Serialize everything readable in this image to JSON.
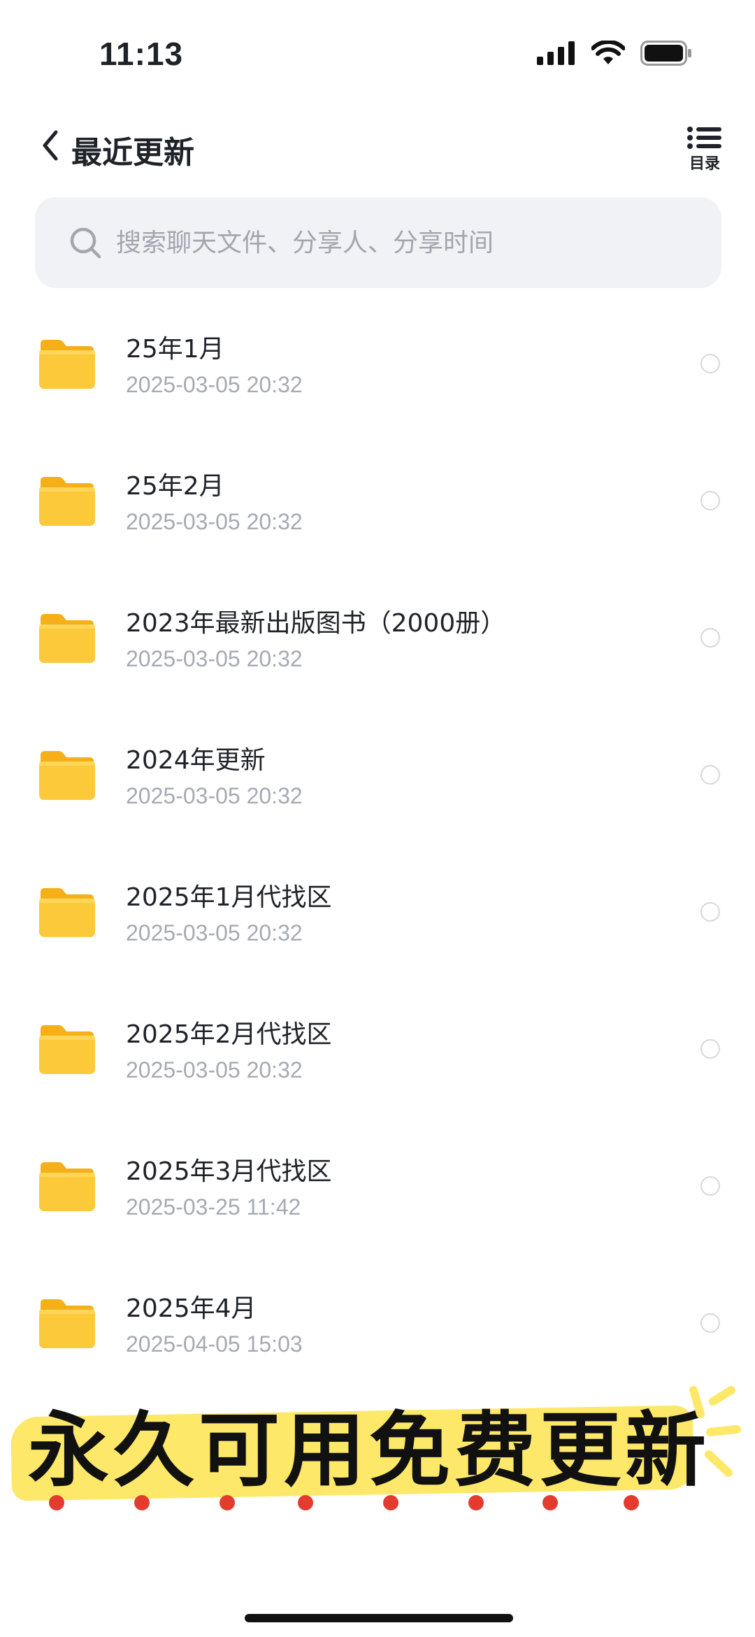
{
  "status_bar": {
    "time": "11:13"
  },
  "header": {
    "title": "最近更新",
    "catalog_label": "目录"
  },
  "search": {
    "placeholder": "搜索聊天文件、分享人、分享时间"
  },
  "files": [
    {
      "name": "25年1月",
      "date": "2025-03-05 20:32"
    },
    {
      "name": "25年2月",
      "date": "2025-03-05 20:32"
    },
    {
      "name": "2023年最新出版图书（2000册）",
      "date": "2025-03-05 20:32"
    },
    {
      "name": "2024年更新",
      "date": "2025-03-05 20:32"
    },
    {
      "name": "2025年1月代找区",
      "date": "2025-03-05 20:32"
    },
    {
      "name": "2025年2月代找区",
      "date": "2025-03-05 20:32"
    },
    {
      "name": "2025年3月代找区",
      "date": "2025-03-25 11:42"
    },
    {
      "name": "2025年4月",
      "date": "2025-04-05 15:03"
    }
  ],
  "banner": {
    "text": "永久可用免费更新"
  },
  "colors": {
    "folder": "#fcc93a",
    "banner_highlight": "#fde869",
    "dots": "#e33b2e"
  }
}
